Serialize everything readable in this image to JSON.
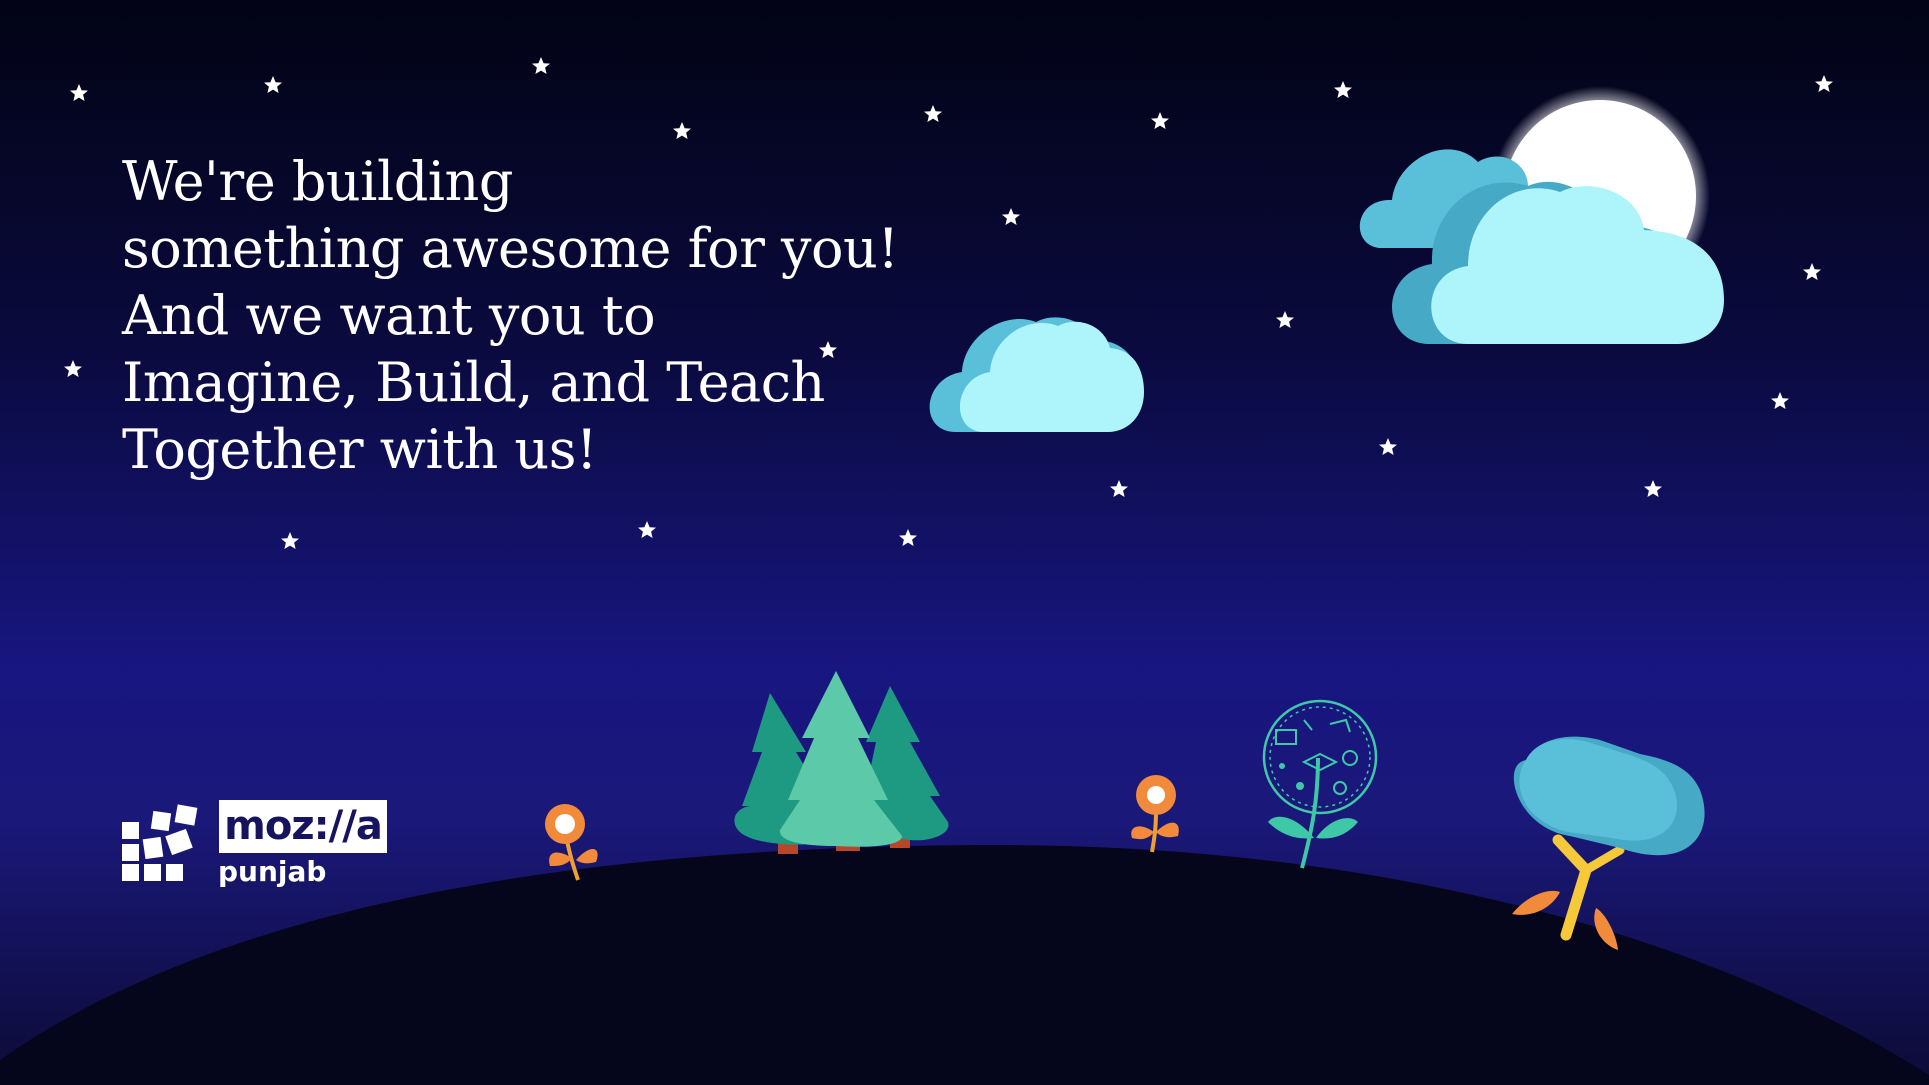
{
  "headline": {
    "lines": [
      "We're building",
      "something awesome for you!",
      "And we want you to",
      "Imagine, Build, and Teach",
      "Together with us!"
    ]
  },
  "logo": {
    "wordmark": "moz://a",
    "region": "punjab"
  },
  "colors": {
    "sky_top": "#020314",
    "sky_mid": "#181680",
    "hill": "#05051c",
    "cloud_light": "#aef4fb",
    "cloud_dark": "#5ac0d9",
    "tree_dark": "#1f9a82",
    "tree_light": "#5ccaa8",
    "trunk": "#b8462a",
    "flower_orange": "#f28a3c",
    "moon": "#ffffff",
    "star": "#ffffff"
  },
  "icons": [
    "star-icon",
    "moon-icon",
    "cloud-icon",
    "pine-tree-icon",
    "flower-icon",
    "education-tree-icon",
    "leaning-tree-icon",
    "logo-mark-icon"
  ]
}
